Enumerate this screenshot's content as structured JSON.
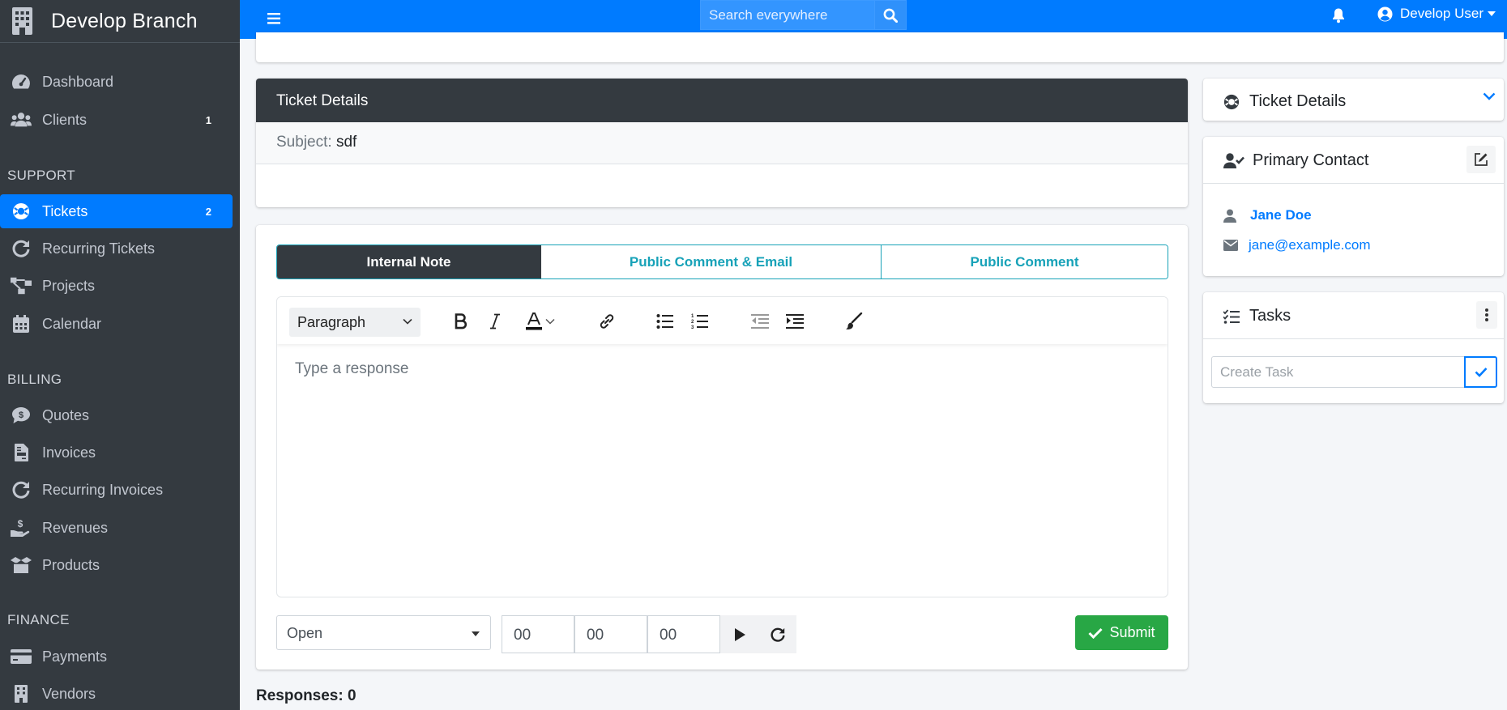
{
  "brand": {
    "name": "Develop Branch",
    "icon": "building-icon"
  },
  "sidebar": {
    "items": [
      {
        "label": "Dashboard",
        "icon": "tachometer-icon",
        "badge": ""
      },
      {
        "label": "Clients",
        "icon": "users-icon",
        "badge": "1"
      }
    ],
    "sections": [
      {
        "header": "SUPPORT",
        "items": [
          {
            "label": "Tickets",
            "icon": "life-ring-icon",
            "badge": "2",
            "active": true
          },
          {
            "label": "Recurring Tickets",
            "icon": "redo-icon"
          },
          {
            "label": "Projects",
            "icon": "project-diagram-icon"
          },
          {
            "label": "Calendar",
            "icon": "calendar-icon"
          }
        ]
      },
      {
        "header": "BILLING",
        "items": [
          {
            "label": "Quotes",
            "icon": "comment-dollar-icon"
          },
          {
            "label": "Invoices",
            "icon": "file-invoice-icon"
          },
          {
            "label": "Recurring Invoices",
            "icon": "redo-icon"
          },
          {
            "label": "Revenues",
            "icon": "hand-holding-usd-icon"
          },
          {
            "label": "Products",
            "icon": "box-open-icon"
          }
        ]
      },
      {
        "header": "FINANCE",
        "items": [
          {
            "label": "Payments",
            "icon": "credit-card-icon"
          },
          {
            "label": "Vendors",
            "icon": "building-icon"
          }
        ]
      }
    ]
  },
  "topbar": {
    "search_placeholder": "Search everywhere",
    "user_name": "Develop User"
  },
  "ticket": {
    "header": "Ticket Details",
    "subject_label": "Subject:",
    "subject_value": "sdf"
  },
  "reply": {
    "tabs": [
      "Internal Note",
      "Public Comment & Email",
      "Public Comment"
    ],
    "active_tab": "Internal Note",
    "editor": {
      "block_format": "Paragraph",
      "placeholder": "Type a response"
    },
    "status": "Open",
    "timer": {
      "hours": "00",
      "minutes": "00",
      "seconds": "00"
    },
    "submit_label": "Submit"
  },
  "responses_label": "Responses: 0",
  "right": {
    "details_title": "Ticket Details",
    "primary_contact_title": "Primary Contact",
    "contact_name": "Jane Doe",
    "contact_email": "jane@example.com",
    "tasks_title": "Tasks",
    "task_placeholder": "Create Task"
  },
  "colors": {
    "primary": "#007bff",
    "sidebar": "#343a40",
    "info": "#17a2b8",
    "success": "#28a745"
  }
}
